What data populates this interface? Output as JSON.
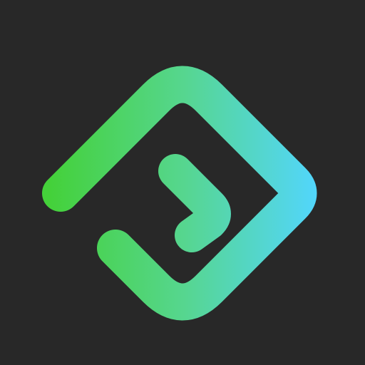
{
  "logo": {
    "icon": "diamond-f-logo-icon",
    "gradient_start_color": "#44D13A",
    "gradient_mid_color": "#56D690",
    "gradient_end_color": "#52D6FF"
  },
  "colors": {
    "background": "#282828"
  }
}
